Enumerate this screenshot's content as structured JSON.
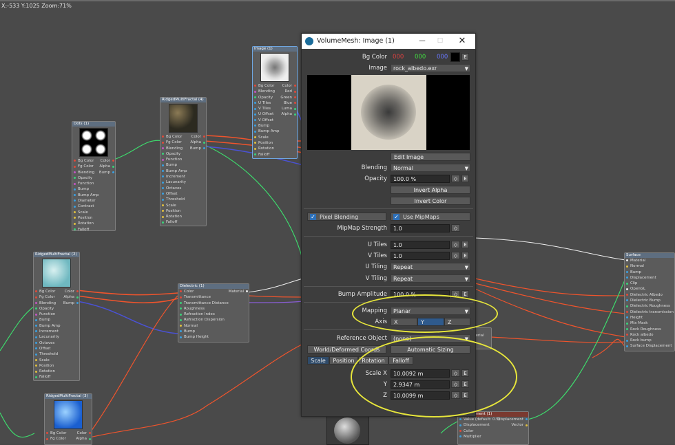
{
  "status_bar": "X:-533 Y:1025 Zoom:71%",
  "nodes": {
    "dots": {
      "title": "Dots (1)",
      "inputs": [
        "Bg Color",
        "Fg Color",
        "Blending",
        "Opacity",
        "Function",
        "Bump",
        "Bump Amp",
        "Diameter",
        "Contrast",
        "Scale",
        "Position",
        "Rotation",
        "Falloff"
      ],
      "outputs": [
        "Color",
        "Alpha",
        "Bump"
      ]
    },
    "ridged4": {
      "title": "RidgedMultiFractal (4)",
      "inputs": [
        "Bg Color",
        "Fg Color",
        "Blending",
        "Opacity",
        "Function",
        "Bump",
        "Bump Amp",
        "Increment",
        "Lacunarity",
        "Octaves",
        "Offset",
        "Threshold",
        "Scale",
        "Position",
        "Rotation",
        "Falloff"
      ],
      "outputs": [
        "Color",
        "Alpha",
        "Bump"
      ]
    },
    "image1": {
      "title": "Image (1)",
      "inputs": [
        "Bg Color",
        "Blending",
        "Opacity",
        "U Tiles",
        "V Tiles",
        "U Offset",
        "V Offset",
        "Bump",
        "Bump Amp",
        "Scale",
        "Position",
        "Rotation",
        "Falloff"
      ],
      "outputs": [
        "Color",
        "Red",
        "Green",
        "Blue",
        "Luma",
        "Alpha"
      ]
    },
    "ridged2": {
      "title": "RidgedMultiFractal (2)",
      "inputs": [
        "Bg Color",
        "Fg Color",
        "Blending",
        "Opacity",
        "Function",
        "Bump",
        "Bump Amp",
        "Increment",
        "Lacunarity",
        "Octaves",
        "Offset",
        "Threshold",
        "Scale",
        "Position",
        "Rotation",
        "Falloff"
      ],
      "outputs": [
        "Color",
        "Alpha",
        "Bump"
      ]
    },
    "dielectric": {
      "title": "Dielectric (1)",
      "inputs": [
        "Color",
        "Transmittance",
        "Transmittance Distance",
        "Roughness",
        "Refraction Index",
        "Refraction Dispersion",
        "Normal",
        "Bump",
        "Bump Height"
      ],
      "outputs": [
        "Material"
      ]
    },
    "ridged3": {
      "title": "RidgedMultiFractal (3)",
      "inputs": [
        "Bg Color",
        "Fg Color"
      ],
      "outputs": [
        "Color",
        "Alpha"
      ]
    },
    "surface": {
      "title": "Surface",
      "inputs": [
        "Material",
        "Normal",
        "Bump",
        "Displacement",
        "Clip",
        "OpenGL",
        "Dielectric Albedo",
        "Dielectric Bump",
        "Dielectric Roughness",
        "Dielectric transmission",
        "Height",
        "Mix Mask",
        "Rock Roughness",
        "Rock albedo",
        "Rock bump",
        "Surface Displacement"
      ]
    },
    "displacement": {
      "title": "Displacement (1)",
      "inputs": [
        "Value (default: 0.5)",
        "Displacement",
        "Color",
        "Multiplier"
      ],
      "outputs": [
        "Displacement",
        "Vector"
      ]
    },
    "partial_mat": "aterial"
  },
  "dialog": {
    "title": "VolumeMesh: Image (1)",
    "bg_color": {
      "label": "Bg Color",
      "r": "000",
      "g": "000",
      "b": "000"
    },
    "image": {
      "label": "Image",
      "value": "rock_albedo.exr"
    },
    "edit_image": "Edit Image",
    "blending": {
      "label": "Blending",
      "value": "Normal"
    },
    "opacity": {
      "label": "Opacity",
      "value": "100.0 %"
    },
    "invert_alpha": "Invert Alpha",
    "invert_color": "Invert Color",
    "pixel_blending": "Pixel Blending",
    "use_mipmaps": "Use MipMaps",
    "mipmap_strength": {
      "label": "MipMap Strength",
      "value": "1.0"
    },
    "u_tiles": {
      "label": "U Tiles",
      "value": "1.0"
    },
    "v_tiles": {
      "label": "V Tiles",
      "value": "1.0"
    },
    "u_tiling": {
      "label": "U Tiling",
      "value": "Repeat"
    },
    "v_tiling": {
      "label": "V Tiling",
      "value": "Repeat"
    },
    "bump_amplitude": {
      "label": "Bump Amplitude",
      "value": "100.0 %"
    },
    "mapping": {
      "label": "Mapping",
      "value": "Planar"
    },
    "axis": {
      "label": "Axis",
      "options": [
        "X",
        "Y",
        "Z"
      ],
      "selected": "Y"
    },
    "reference_object": {
      "label": "Reference Object",
      "value": "(none)"
    },
    "world_coords": "World/Deformed Coords",
    "auto_sizing": "Automatic Sizing",
    "tabs": [
      "Scale",
      "Position",
      "Rotation",
      "Falloff"
    ],
    "scale_x": {
      "label": "Scale X",
      "value": "10.0092 m"
    },
    "scale_y": {
      "label": "Y",
      "value": "2.9347 m"
    },
    "scale_z": {
      "label": "Z",
      "value": "10.0099 m"
    },
    "e": "E"
  },
  "colors": {
    "r": "#e04040",
    "g": "#40e040",
    "b": "#5060ff",
    "accent": "#2c6fb8",
    "highlight": "#e7e63b"
  }
}
